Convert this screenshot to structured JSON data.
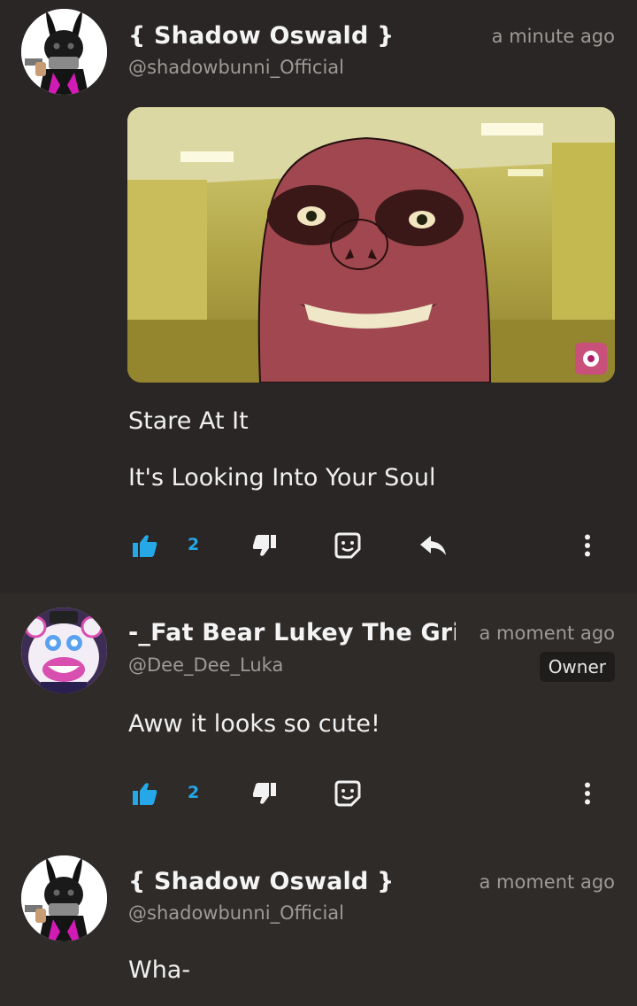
{
  "post": {
    "author": "{ Shadow Oswald }",
    "handle": "@shadowbunni_Official",
    "time": "a minute ago",
    "lines": [
      "Stare At It",
      "It's Looking Into Your Soul"
    ],
    "likes": "2"
  },
  "comments": [
    {
      "author": "-_Fat Bear Lukey The Grill_",
      "handle": "@Dee_Dee_Luka",
      "time": "a moment ago",
      "badge": "Owner",
      "text": "Aww it looks so cute!",
      "likes": "2"
    },
    {
      "author": "{ Shadow Oswald }",
      "handle": "@shadowbunni_Official",
      "time": "a moment ago",
      "text": "Wha-"
    }
  ],
  "colors": {
    "accent": "#25a7e8",
    "background": "#2e2b29",
    "post_background": "#292625",
    "muted_text": "#9e9a97"
  },
  "icons": [
    "thumbs-up-icon",
    "thumbs-down-icon",
    "sticker-icon",
    "reply-icon",
    "more-vertical-icon"
  ]
}
